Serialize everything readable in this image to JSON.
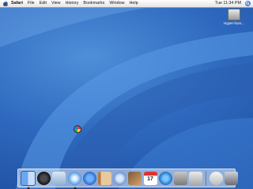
{
  "menubar": {
    "app_name": "Safari",
    "items": [
      "File",
      "Edit",
      "View",
      "History",
      "Bookmarks",
      "Window",
      "Help"
    ],
    "clock": "Tue 11:34 PM"
  },
  "desktop": {
    "disk_label": "Hyper-hom..."
  },
  "dock": {
    "ical_day": "17",
    "items": [
      "finder",
      "dashboard",
      "mail",
      "safari",
      "ichat",
      "address-book",
      "itunes",
      "iphoto",
      "ical",
      "quicktime",
      "system-preferences",
      "apple",
      "documents",
      "trash"
    ]
  },
  "colors": {
    "desktop_blue": "#2e69bf",
    "menubar": "#eeeeee"
  }
}
